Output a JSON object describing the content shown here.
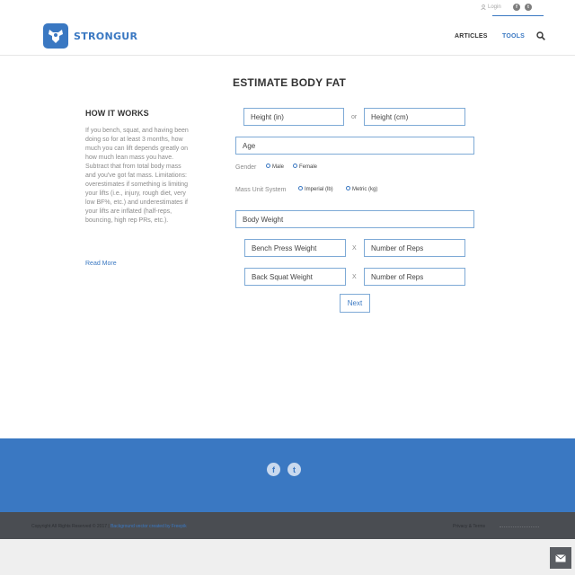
{
  "header": {
    "brand": "STRONGUR",
    "login": "Login",
    "nav": {
      "articles": "ARTICLES",
      "tools": "TOOLS"
    },
    "social": {
      "facebook": "f",
      "twitter": "t"
    }
  },
  "sidebar": {
    "title": "HOW IT WORKS",
    "body": "If you bench, squat, and having been doing so for at least 3 months, how much you can lift depends greatly on how much lean mass you have. Subtract that from total body mass and you've got fat mass. Limitations: overestimates if something is limiting your lifts (i.e., injury, rough diet, very low BF%, etc.) and underestimates if your lifts are inflated (half-reps, bouncing, high rep PRs, etc.).",
    "read_more": "Read More"
  },
  "form": {
    "title": "ESTIMATE BODY FAT",
    "height_in": "Height (in)",
    "or": "or",
    "height_cm": "Height (cm)",
    "age": "Age",
    "gender_label": "Gender",
    "gender_male": "Male",
    "gender_female": "Female",
    "mass_label": "Mass Unit System",
    "mass_imperial": "Imperial (lb)",
    "mass_metric": "Metric (kg)",
    "body_weight": "Body Weight",
    "bench_weight": "Bench Press Weight",
    "bench_reps": "Number of Reps",
    "squat_weight": "Back Squat Weight",
    "squat_reps": "Number of Reps",
    "times": "X",
    "next": "Next"
  },
  "footer": {
    "facebook": "f",
    "twitter": "t",
    "copyright": "Copyright All Rights Reserved © 2017 | ",
    "credit": "Background vector created by Freepik",
    "privacy": "Privacy & Terms"
  },
  "colors": {
    "accent": "#3a78c2",
    "footer_dark": "#4a4d52"
  }
}
